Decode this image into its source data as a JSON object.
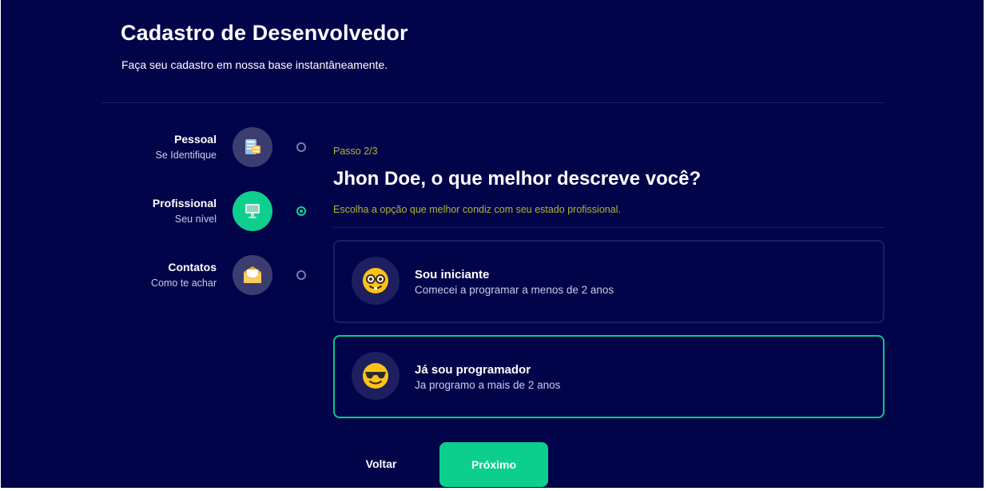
{
  "header": {
    "title": "Cadastro de Desenvolvedor",
    "subtitle": "Faça seu cadastro em nossa base instantâneamente."
  },
  "steps": [
    {
      "title": "Pessoal",
      "subtitle": "Se Identifique",
      "icon": "id-card-icon",
      "state": "done"
    },
    {
      "title": "Profissional",
      "subtitle": "Seu nível",
      "icon": "computer-icon",
      "state": "active"
    },
    {
      "title": "Contatos",
      "subtitle": "Como te achar",
      "icon": "envelope-icon",
      "state": "pending"
    }
  ],
  "main": {
    "step_label": "Passo 2/3",
    "question": "Jhon Doe, o que melhor descreve você?",
    "hint": "Escolha a opção que melhor condiz com seu estado profissional.",
    "options": [
      {
        "title": "Sou iniciante",
        "subtitle": "Comecei a programar a menos de 2 anos",
        "icon": "nerd-face-icon",
        "selected": false
      },
      {
        "title": "Já sou programador",
        "subtitle": "Ja programo a mais de 2 anos",
        "icon": "sunglasses-face-icon",
        "selected": true
      }
    ]
  },
  "actions": {
    "back_label": "Voltar",
    "next_label": "Próximo"
  },
  "colors": {
    "background": "#02044a",
    "accent": "#0ccf8d",
    "step_label": "#b0b532"
  }
}
